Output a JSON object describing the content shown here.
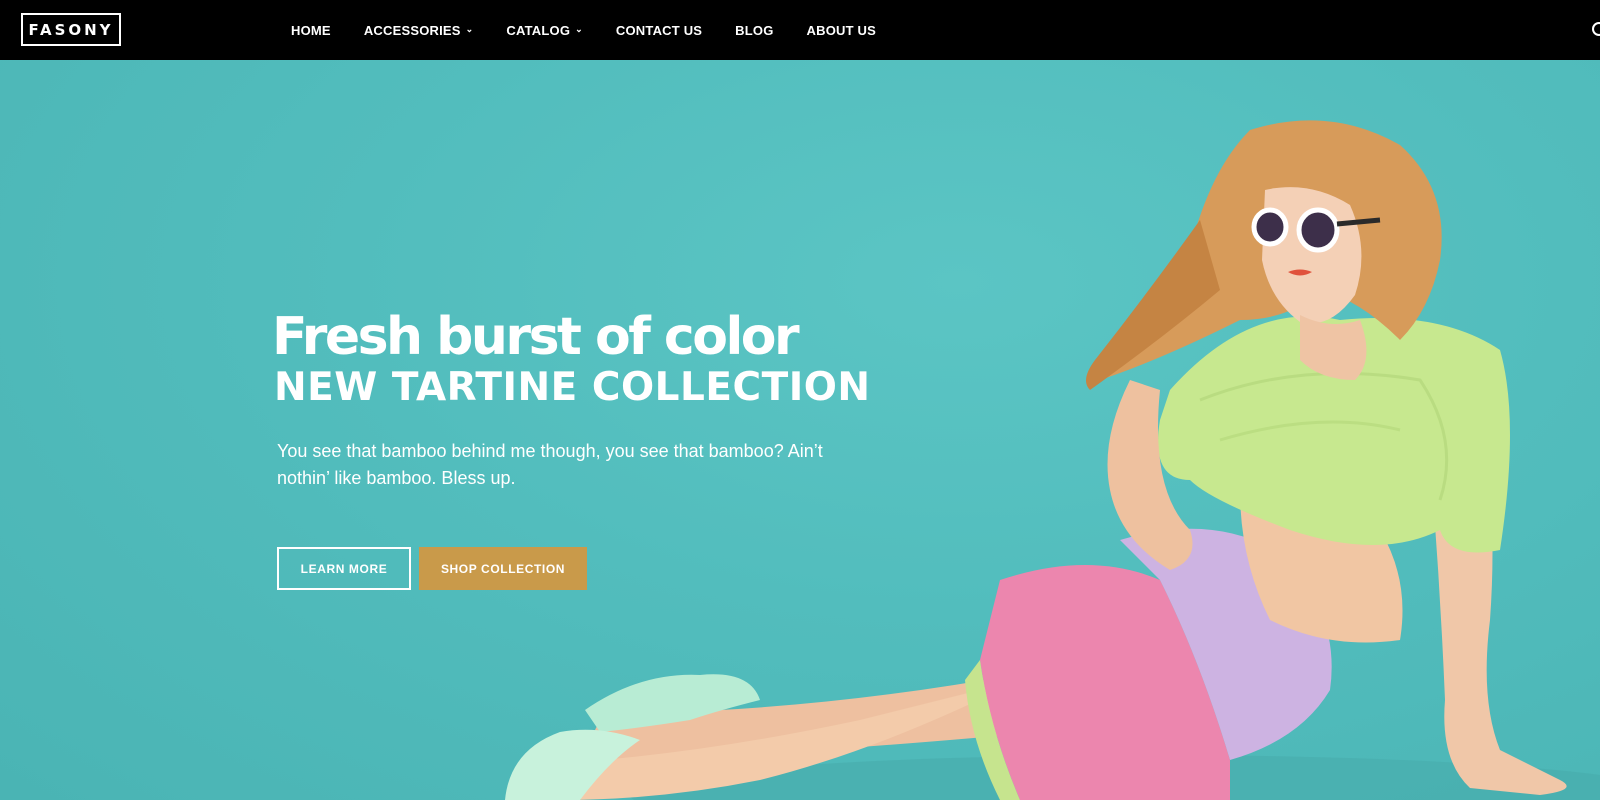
{
  "brand": {
    "logo_text": "FASONY"
  },
  "nav": {
    "items": [
      {
        "label": "HOME",
        "has_dropdown": false
      },
      {
        "label": "ACCESSORIES",
        "has_dropdown": true
      },
      {
        "label": "CATALOG",
        "has_dropdown": true
      },
      {
        "label": "CONTACT US",
        "has_dropdown": false
      },
      {
        "label": "BLOG",
        "has_dropdown": false
      },
      {
        "label": "ABOUT US",
        "has_dropdown": false
      }
    ],
    "search_icon": "search-icon"
  },
  "hero": {
    "headline": "Fresh burst of color",
    "subheadline": "NEW TARTINE COLLECTION",
    "body": "You see that bamboo behind me though, you see that bamboo? Ain’t nothin’ like bamboo. Bless up.",
    "learn_more_label": "LEARN MORE",
    "shop_collection_label": "SHOP COLLECTION"
  },
  "colors": {
    "nav_background": "#000000",
    "hero_background": "#52bdbd",
    "accent_button": "#c99a4a",
    "text": "#ffffff"
  }
}
